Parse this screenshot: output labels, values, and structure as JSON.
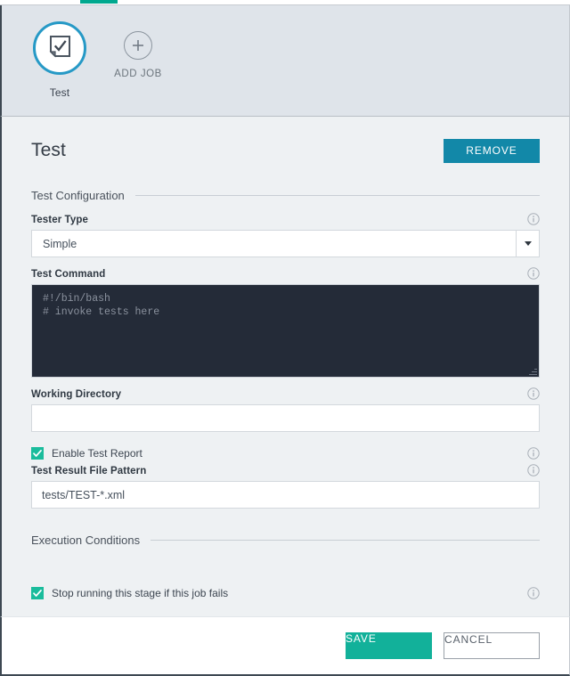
{
  "tabstrip": {
    "active_tab_accent": "#00a88f"
  },
  "jobs_bar": {
    "jobs": [
      {
        "label": "Test",
        "icon": "test-checklist-icon",
        "selected": true,
        "ring_color": "#2699c6"
      }
    ],
    "add_job": {
      "label": "ADD JOB",
      "icon": "plus-circle-icon"
    }
  },
  "panel": {
    "title": "Test",
    "remove_button": "REMOVE",
    "remove_color": "#1288a8",
    "sections": [
      {
        "id": "test_configuration",
        "title": "Test Configuration"
      },
      {
        "id": "execution_conditions",
        "title": "Execution Conditions"
      }
    ],
    "fields": {
      "tester_type": {
        "label": "Tester Type",
        "value": "Simple",
        "options": [
          "Simple"
        ],
        "info": "info-icon"
      },
      "test_command": {
        "label": "Test Command",
        "lines": [
          "#!/bin/bash",
          "# invoke tests here"
        ],
        "value": "#!/bin/bash\n# invoke tests here",
        "bg": "#242b38",
        "fg": "#8b929e",
        "info": "info-icon"
      },
      "working_directory": {
        "label": "Working Directory",
        "value": "",
        "placeholder": "",
        "info": "info-icon"
      },
      "enable_test_report": {
        "label": "Enable Test Report",
        "checked": true,
        "info": "info-icon"
      },
      "test_result_file_pattern": {
        "label": "Test Result File Pattern",
        "value": "tests/TEST-*.xml",
        "placeholder": "",
        "info": "info-icon"
      },
      "stop_on_fail": {
        "label": "Stop running this stage if this job fails",
        "checked": true,
        "info": "info-icon"
      }
    }
  },
  "footer": {
    "save_label": "SAVE",
    "cancel_label": "CANCEL",
    "save_color": "#12b19a"
  }
}
